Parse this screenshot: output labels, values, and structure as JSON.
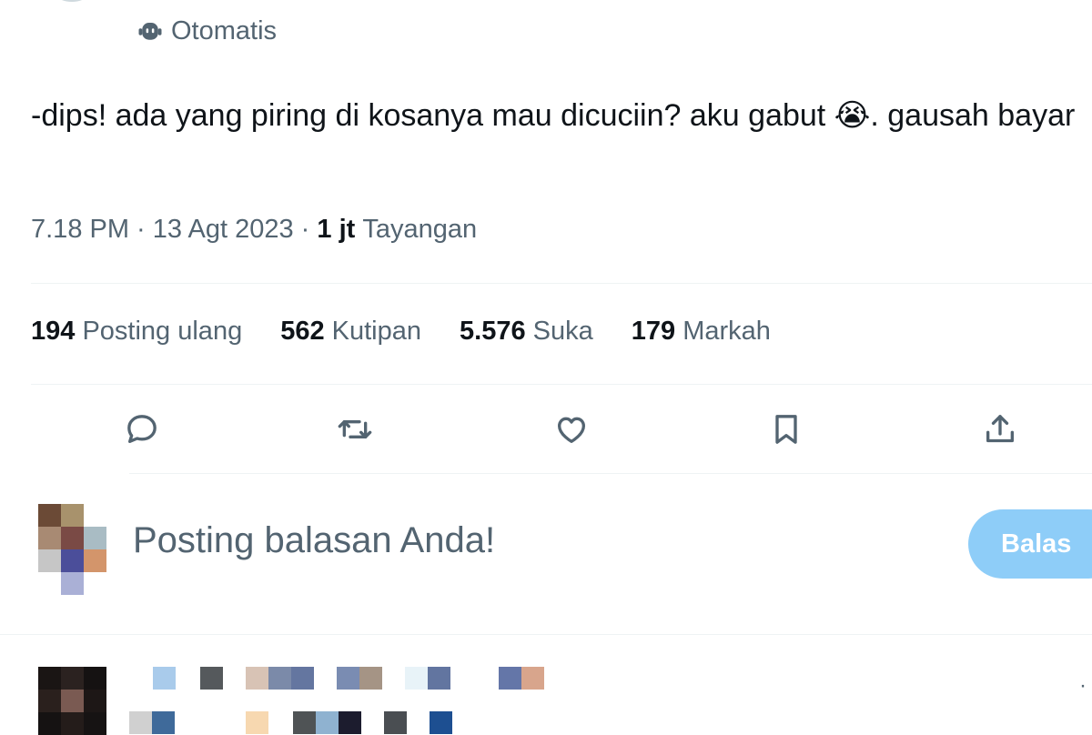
{
  "author": {
    "automated_label": "Otomatis"
  },
  "tweet": {
    "text": "-dips! ada yang piring di kosanya mau dicuciin? aku gabut 😭. gausah bayar",
    "time": "7.18 PM",
    "separator": " · ",
    "date": "13 Agt 2023",
    "views_count": "1 jt",
    "views_label": "Tayangan"
  },
  "stats": [
    {
      "count": "194",
      "label": "Posting ulang"
    },
    {
      "count": "562",
      "label": "Kutipan"
    },
    {
      "count": "5.576",
      "label": "Suka"
    },
    {
      "count": "179",
      "label": "Markah"
    }
  ],
  "actions": [
    "reply-icon",
    "retweet-icon",
    "like-icon",
    "bookmark-icon",
    "share-icon"
  ],
  "reply_box": {
    "placeholder": "Posting balasan Anda!",
    "button_label": "Balas"
  },
  "next_reply": {
    "more_icon": "more-icon",
    "more_glyph": "·"
  },
  "colors": {
    "secondary_text": "#536471",
    "primary_text": "#0f1419",
    "accent_disabled": "#8ecdf8",
    "divider": "#eff3f4"
  }
}
